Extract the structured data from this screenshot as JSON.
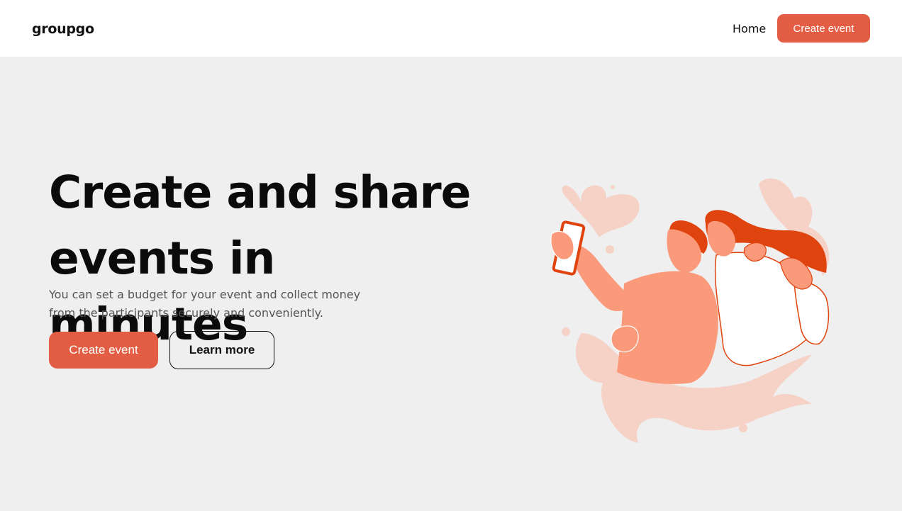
{
  "header": {
    "logo": "groupgo",
    "nav_home": "Home",
    "nav_cta": "Create event"
  },
  "hero": {
    "title_line1": "Create and share",
    "title_line2": "events in minutes",
    "subtitle_line1": "You can set a budget for your event and collect money",
    "subtitle_line2": "from the participants securely and conveniently.",
    "primary_button": "Create event",
    "secondary_button": "Learn more"
  },
  "colors": {
    "accent": "#e35d45",
    "background": "#efefef",
    "header_bg": "#ffffff",
    "illustration_light": "#f6d2c6",
    "illustration_mid": "#fa9a7b",
    "illustration_dark": "#e0440e"
  },
  "illustration": {
    "icon": "two-people-selfie-illustration"
  }
}
